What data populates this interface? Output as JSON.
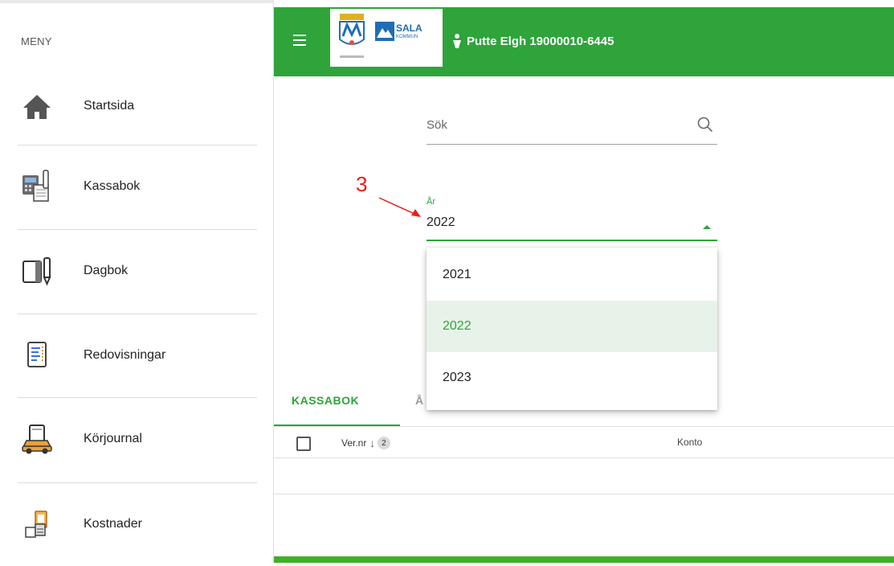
{
  "sidebar": {
    "heading": "MENY",
    "items": [
      {
        "label": "Startsida",
        "icon": "home-icon"
      },
      {
        "label": "Kassabok",
        "icon": "cashbook-icon"
      },
      {
        "label": "Dagbok",
        "icon": "diary-icon"
      },
      {
        "label": "Redovisningar",
        "icon": "report-icon"
      },
      {
        "label": "Körjournal",
        "icon": "car-icon"
      },
      {
        "label": "Kostnader",
        "icon": "costs-icon"
      }
    ]
  },
  "header": {
    "logo_text": "SALA",
    "logo_subtext": "KOMMUN",
    "user": "Putte Elgh 19000010-6445",
    "colors": {
      "primary": "#2ea43a"
    }
  },
  "search": {
    "placeholder": "Sök"
  },
  "year_select": {
    "label": "År",
    "value": "2022",
    "options": [
      "2021",
      "2022",
      "2023"
    ],
    "selected_index": 1
  },
  "annotation": {
    "number": "3"
  },
  "tabs": [
    {
      "label": "KASSABOK",
      "active": true
    },
    {
      "label": "Å",
      "active": false
    }
  ],
  "table": {
    "columns": {
      "vernr": "Ver.nr",
      "sort_badge": "2",
      "konto": "Konto"
    }
  }
}
